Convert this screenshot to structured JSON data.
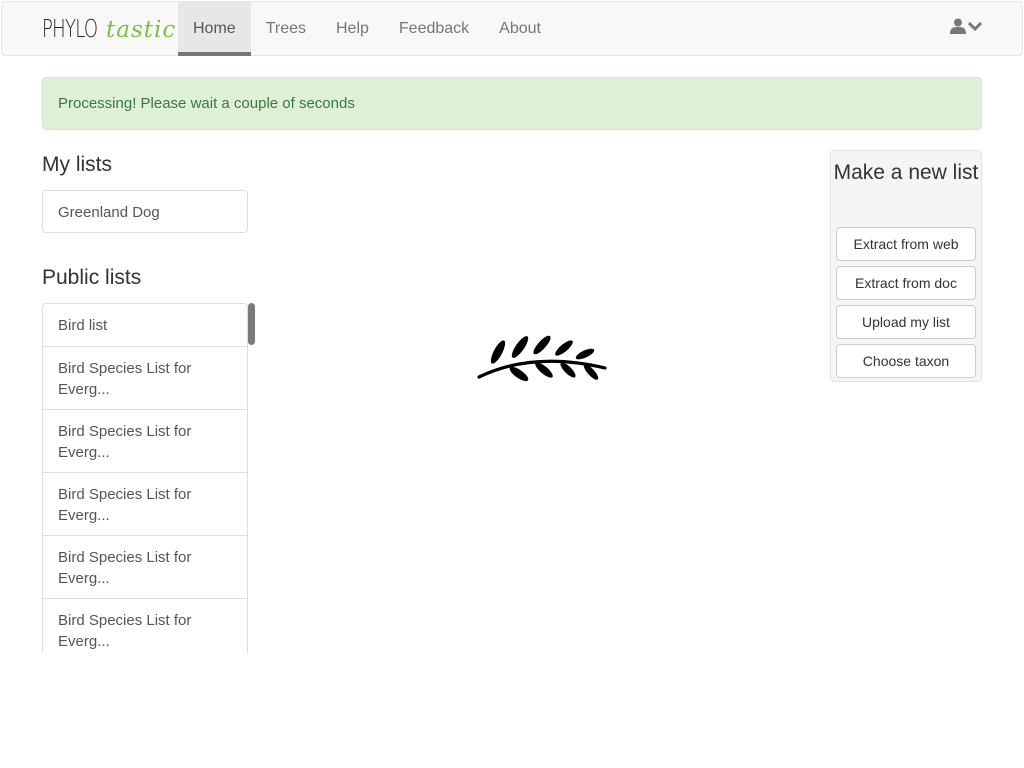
{
  "brand": {
    "part1": "PHYLO",
    "part2": "tastic"
  },
  "nav": {
    "items": [
      {
        "label": "Home",
        "active": true
      },
      {
        "label": "Trees",
        "active": false
      },
      {
        "label": "Help",
        "active": false
      },
      {
        "label": "Feedback",
        "active": false
      },
      {
        "label": "About",
        "active": false
      }
    ],
    "user_icon": "user-icon",
    "dropdown_icon": "chevron-down-icon"
  },
  "alert": {
    "text": "Processing! Please wait a couple of seconds"
  },
  "my_lists": {
    "title": "My lists",
    "items": [
      "Greenland Dog"
    ]
  },
  "public_lists": {
    "title": "Public lists",
    "items": [
      "Bird list",
      "Bird Species List for Everg...",
      "Bird Species List for Everg...",
      "Bird Species List for Everg...",
      "Bird Species List for Everg...",
      "Bird Species List for Everg..."
    ]
  },
  "spinner_icon": "leaf-branch-icon",
  "new_list": {
    "title": "Make a new list",
    "buttons": [
      "Extract from web",
      "Extract from doc",
      "Upload my list",
      "Choose taxon"
    ]
  },
  "colors": {
    "brand_green": "#7ac143",
    "alert_bg": "#dff0d8",
    "alert_text": "#3c763d",
    "navbar_bg": "#f8f8f8"
  }
}
